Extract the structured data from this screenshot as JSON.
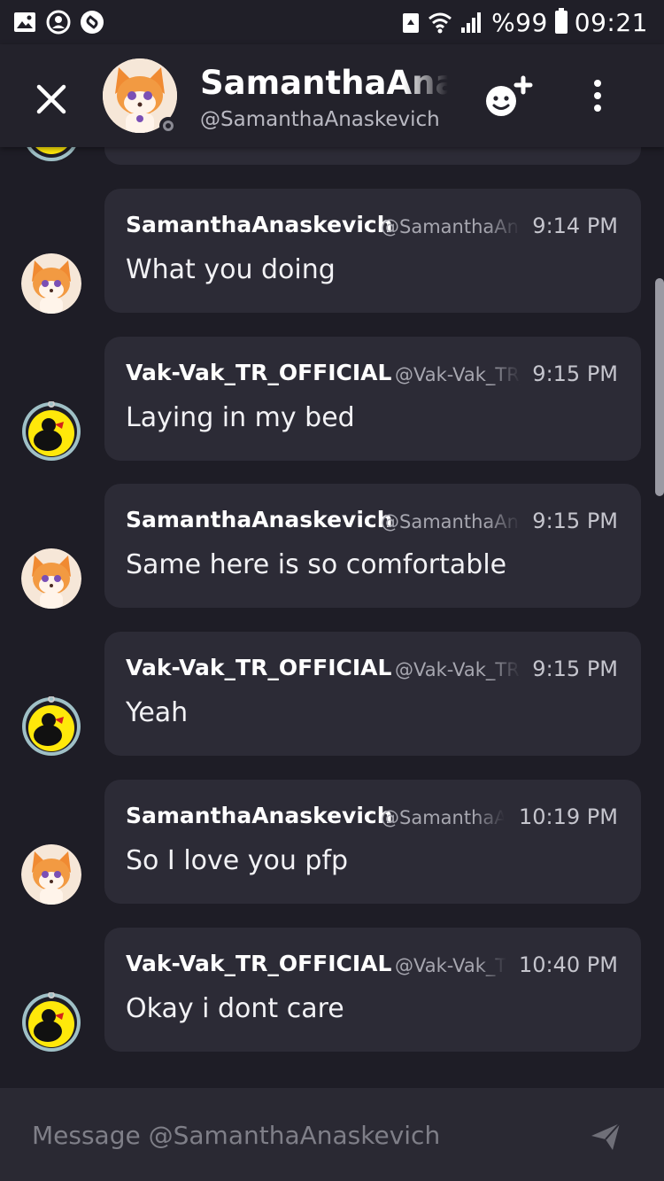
{
  "status_bar": {
    "battery_text": "%99",
    "time": "09:21",
    "icons": [
      "image-icon",
      "messenger-icon",
      "shazam-icon",
      "recycle-icon",
      "wifi-icon",
      "signal-icon",
      "battery-icon"
    ]
  },
  "header": {
    "title": "SamanthaAnaskevich",
    "handle": "@SamanthaAnaskevich",
    "presence": "offline",
    "icons": [
      "close-icon",
      "add-friend-icon",
      "more-vertical-icon"
    ]
  },
  "messages": [
    {
      "author": "SamanthaAnaskevich",
      "handle": "@SamanthaAnaskevich",
      "time": "9:14 PM",
      "text": "What you doing",
      "avatar": "fox"
    },
    {
      "author": "Vak-Vak_TR_OFFICIAL",
      "handle": "@Vak-Vak_TR_OFFICIAL",
      "time": "9:15 PM",
      "text": "Laying in my bed",
      "avatar": "duck"
    },
    {
      "author": "SamanthaAnaskevich",
      "handle": "@SamanthaAnaskevich",
      "time": "9:15 PM",
      "text": "Same here is so comfortable",
      "avatar": "fox"
    },
    {
      "author": "Vak-Vak_TR_OFFICIAL",
      "handle": "@Vak-Vak_TR_OFFICIAL",
      "time": "9:15 PM",
      "text": "Yeah",
      "avatar": "duck"
    },
    {
      "author": "SamanthaAnaskevich",
      "handle": "@SamanthaAnaskevich",
      "time": "10:19 PM",
      "text": "So I love you pfp",
      "avatar": "fox"
    },
    {
      "author": "Vak-Vak_TR_OFFICIAL",
      "handle": "@Vak-Vak_TR_OFFICIAL",
      "time": "10:40 PM",
      "text": "Okay i dont care",
      "avatar": "duck"
    }
  ],
  "composer": {
    "placeholder": "Message @SamanthaAnaskevich",
    "icon": "send-icon"
  },
  "colors": {
    "background": "#1e1d26",
    "bubble": "#2c2b36",
    "header": "#23222b",
    "composer": "#2a2933"
  }
}
